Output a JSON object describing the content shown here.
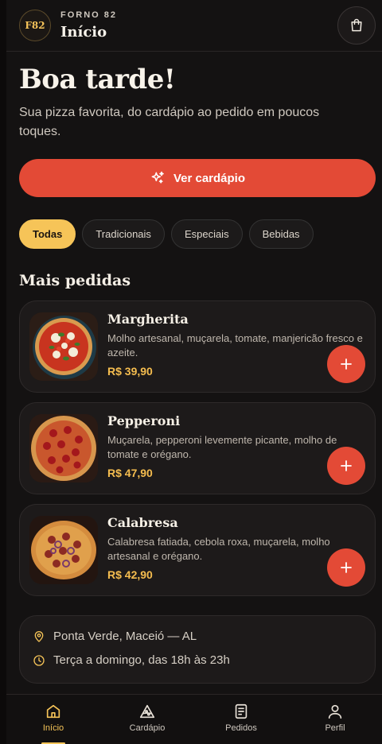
{
  "header": {
    "logo_text": "F82",
    "brand": "FORNO 82",
    "title": "Início",
    "cart_icon": "shopping-bag-icon"
  },
  "hero": {
    "greeting": "Boa tarde!",
    "subtitle": "Sua pizza favorita, do cardápio ao pedido em poucos toques.",
    "cta_label": "Ver cardápio",
    "cta_icon": "sparkles-icon"
  },
  "filters": [
    {
      "label": "Todas",
      "active": true
    },
    {
      "label": "Tradicionais",
      "active": false
    },
    {
      "label": "Especiais",
      "active": false
    },
    {
      "label": "Bebidas",
      "active": false
    }
  ],
  "section_title": "Mais pedidas",
  "products": [
    {
      "name": "Margherita",
      "description": "Molho artesanal, muçarela, tomate, manjericão fresco e azeite.",
      "price": "R$ 39,90"
    },
    {
      "name": "Pepperoni",
      "description": "Muçarela, pepperoni levemente picante, molho de tomate e orégano.",
      "price": "R$ 47,90"
    },
    {
      "name": "Calabresa",
      "description": "Calabresa fatiada, cebola roxa, muçarela, molho artesanal e orégano.",
      "price": "R$ 42,90"
    }
  ],
  "info": {
    "location": "Ponta Verde, Maceió — AL",
    "hours": "Terça a domingo, das 18h às 23h"
  },
  "nav": [
    {
      "label": "Início",
      "icon": "home-icon",
      "active": true
    },
    {
      "label": "Cardápio",
      "icon": "pizza-slice-icon",
      "active": false
    },
    {
      "label": "Pedidos",
      "icon": "receipt-icon",
      "active": false
    },
    {
      "label": "Perfil",
      "icon": "user-icon",
      "active": false
    }
  ],
  "colors": {
    "accent": "#e34a36",
    "gold": "#f6c458",
    "background": "#141212"
  }
}
